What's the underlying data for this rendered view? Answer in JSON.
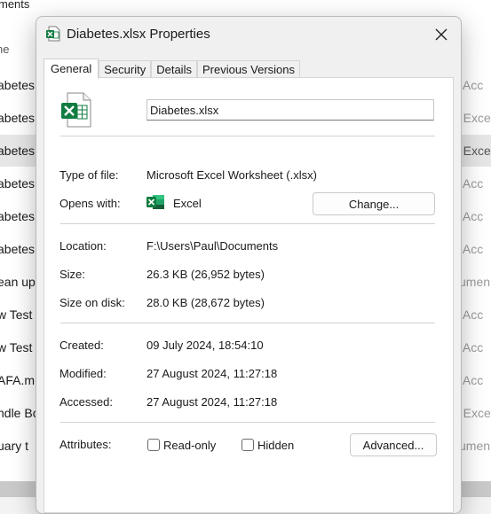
{
  "background": {
    "header_text": "ments",
    "name_column_fragment": "ne",
    "rows": [
      {
        "name": "abetes",
        "type": "ft Acc",
        "selected": false
      },
      {
        "name": "abetes",
        "type": "ft Exce",
        "selected": false
      },
      {
        "name": "abetes",
        "type": "ft Exce",
        "selected": true
      },
      {
        "name": "abetes",
        "type": "ft Acc",
        "selected": false
      },
      {
        "name": "abetes",
        "type": "ft Acc",
        "selected": false
      },
      {
        "name": "abetes",
        "type": "ft Acc",
        "selected": false
      },
      {
        "name": "ean up",
        "type": "cumen",
        "selected": false
      },
      {
        "name": "w Test",
        "type": "ft Acc",
        "selected": false
      },
      {
        "name": "w Test",
        "type": "ft Acc",
        "selected": false
      },
      {
        "name": "AFA.m",
        "type": "ft Acc",
        "selected": false
      },
      {
        "name": "ndle Bo",
        "type": "ft Exce",
        "selected": false
      },
      {
        "name": "uary t",
        "type": "cumen",
        "selected": false
      }
    ]
  },
  "dialog": {
    "title": "Diabetes.xlsx Properties",
    "close_icon": "close-icon",
    "tabs": [
      {
        "label": "General",
        "active": true
      },
      {
        "label": "Security",
        "active": false
      },
      {
        "label": "Details",
        "active": false
      },
      {
        "label": "Previous Versions",
        "active": false
      }
    ],
    "general": {
      "file_icon": "excel-file-icon",
      "filename": "Diabetes.xlsx",
      "type_of_file_label": "Type of file:",
      "type_of_file_value": "Microsoft Excel Worksheet (.xlsx)",
      "opens_with_label": "Opens with:",
      "opens_with_app": "Excel",
      "change_button": "Change...",
      "location_label": "Location:",
      "location_value": "F:\\Users\\Paul\\Documents",
      "size_label": "Size:",
      "size_value": "26.3 KB (26,952 bytes)",
      "size_on_disk_label": "Size on disk:",
      "size_on_disk_value": "28.0 KB (28,672 bytes)",
      "created_label": "Created:",
      "created_value": "09 July 2024, 18:54:10",
      "modified_label": "Modified:",
      "modified_value": "27 August 2024, 11:27:18",
      "accessed_label": "Accessed:",
      "accessed_value": "27 August 2024, 11:27:18",
      "attributes_label": "Attributes:",
      "readonly_label": "Read-only",
      "readonly_checked": false,
      "hidden_label": "Hidden",
      "hidden_checked": false,
      "advanced_button": "Advanced..."
    }
  },
  "colors": {
    "excel_green": "#107C41",
    "excel_dark_green": "#185C37",
    "selected_row": "#e6e6e6"
  }
}
